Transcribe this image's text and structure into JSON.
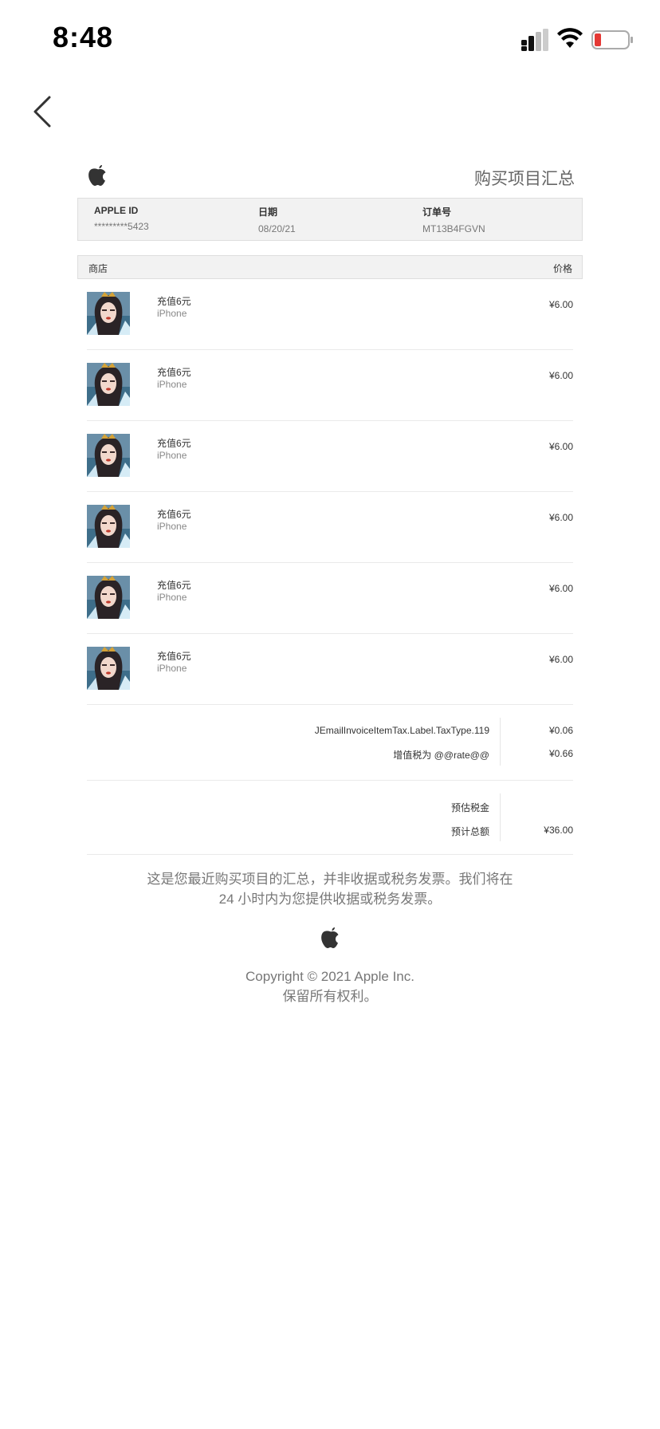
{
  "status_bar": {
    "time": "8:48"
  },
  "header": {
    "title": "购买项目汇总"
  },
  "meta": {
    "apple_id_label": "APPLE ID",
    "apple_id_value": "*********5423",
    "date_label": "日期",
    "date_value": "08/20/21",
    "order_label": "订单号",
    "order_value": "MT13B4FGVN"
  },
  "table": {
    "store_label": "商店",
    "price_label": "价格"
  },
  "items": [
    {
      "name": "充值6元",
      "device": "iPhone",
      "price": "¥6.00"
    },
    {
      "name": "充值6元",
      "device": "iPhone",
      "price": "¥6.00"
    },
    {
      "name": "充值6元",
      "device": "iPhone",
      "price": "¥6.00"
    },
    {
      "name": "充值6元",
      "device": "iPhone",
      "price": "¥6.00"
    },
    {
      "name": "充值6元",
      "device": "iPhone",
      "price": "¥6.00"
    },
    {
      "name": "充值6元",
      "device": "iPhone",
      "price": "¥6.00"
    }
  ],
  "tax": {
    "line1_label": "JEmailInvoiceItemTax.Label.TaxType.119",
    "line1_value": "¥0.06",
    "line2_label": "增值税为 @@rate@@",
    "line2_value": "¥0.66"
  },
  "totals": {
    "est_tax_label": "预估税金",
    "est_total_label": "预计总额",
    "est_total_value": "¥36.00"
  },
  "footer": {
    "note_line1": "这是您最近购买项目的汇总，并非收据或税务发票。我们将在",
    "note_line2": "24 小时内为您提供收据或税务发票。",
    "copyright": "Copyright © 2021 Apple Inc.",
    "rights": "保留所有权利。"
  },
  "icons": {
    "back": "chevron-left-icon",
    "logo": "apple-logo-icon",
    "signal": "cellular-signal-icon",
    "wifi": "wifi-icon",
    "battery": "battery-low-icon"
  },
  "colors": {
    "battery_low": "#e53935",
    "header_gray": "#f2f2f2"
  }
}
